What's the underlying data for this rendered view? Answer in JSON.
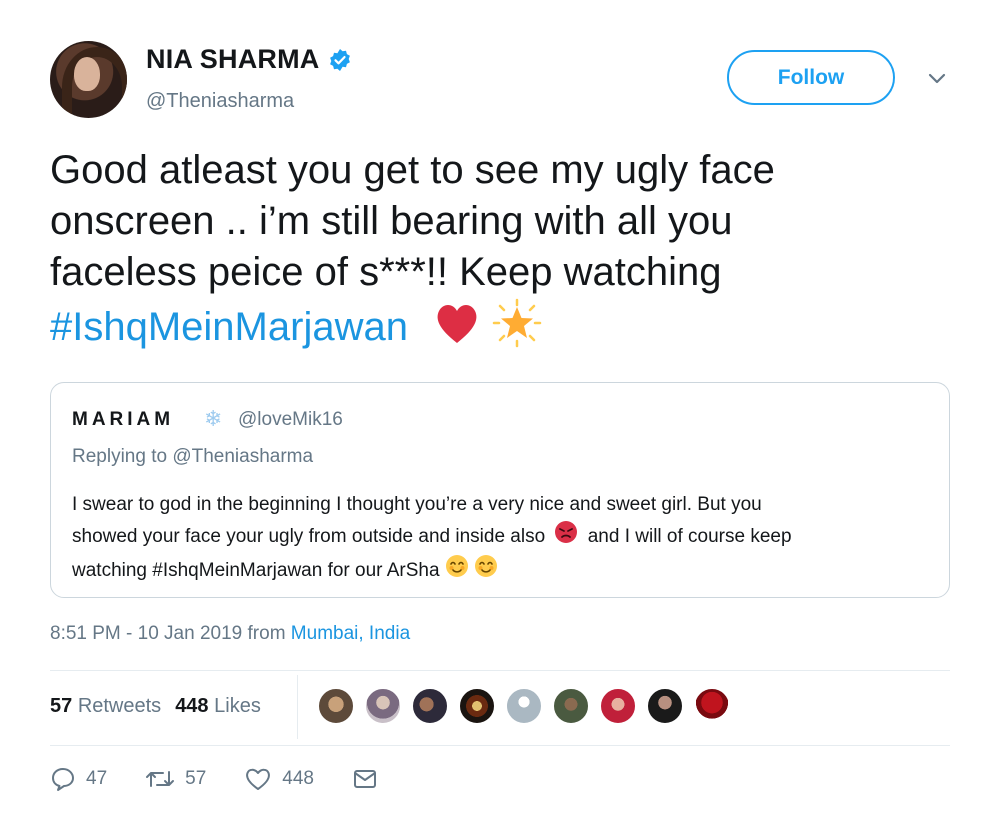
{
  "tweet": {
    "author": {
      "display_name": "NIA SHARMA",
      "handle": "@Theniasharma",
      "verified": true
    },
    "follow_label": "Follow",
    "text_lines": [
      "Good atleast you get to see my ugly face",
      "onscreen .. i’m still bearing with all you",
      "faceless peice of s***!! Keep watching"
    ],
    "hashtag": "#IshqMeinMarjawan",
    "emojis": [
      "red-heart-emoji",
      "glowing-star-emoji"
    ],
    "quoted": {
      "display_name": "MARIAM",
      "name_decoration": "❄",
      "handle": "@loveMik16",
      "replying_to": "Replying to @Theniasharma",
      "text_lines": [
        "I swear to god in the beginning I thought you’re a very nice and sweet girl. But you",
        "showed your face your ugly from outside and inside also",
        "and I will of course keep",
        "watching #IshqMeinMarjawan for our ArSha"
      ]
    },
    "timestamp": "8:51 PM - 10 Jan 2019 from",
    "location": "Mumbai, India",
    "retweets_count": "57",
    "retweets_label": "Retweets",
    "likes_count": "448",
    "likes_label": "Likes",
    "actions": {
      "reply_count": "47",
      "retweet_count": "57",
      "like_count": "448"
    },
    "colors": {
      "accent": "#1da1f2",
      "link": "#1b95e0",
      "muted": "#657786",
      "border": "#ccd6dd"
    }
  }
}
